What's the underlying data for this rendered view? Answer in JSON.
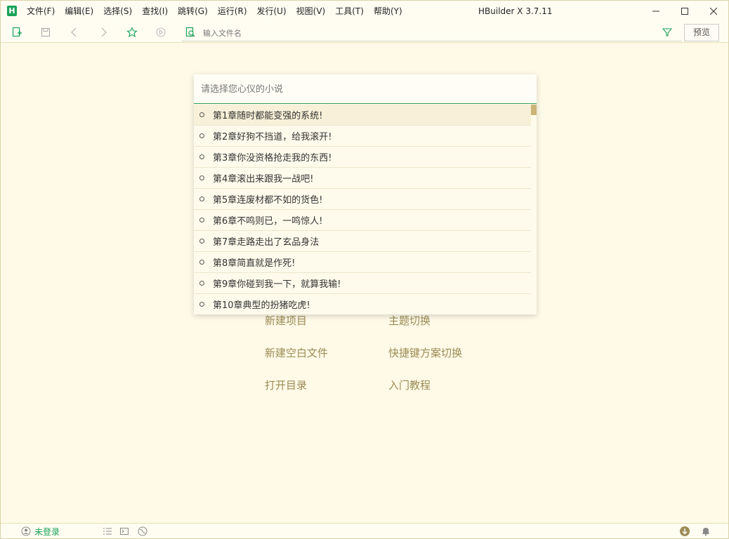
{
  "app": {
    "logo_letter": "H",
    "title": "HBuilder X 3.7.11"
  },
  "menu": [
    {
      "label": "文件(F)"
    },
    {
      "label": "编辑(E)"
    },
    {
      "label": "选择(S)"
    },
    {
      "label": "查找(I)"
    },
    {
      "label": "跳转(G)"
    },
    {
      "label": "运行(R)"
    },
    {
      "label": "发行(U)"
    },
    {
      "label": "视图(V)"
    },
    {
      "label": "工具(T)"
    },
    {
      "label": "帮助(Y)"
    }
  ],
  "toolbar": {
    "file_search_placeholder": "输入文件名",
    "preview_label": "预览"
  },
  "picker": {
    "placeholder": "请选择您心仪的小说",
    "items": [
      {
        "label": "第1章随时都能变强的系统!"
      },
      {
        "label": "第2章好狗不挡道，给我滚开!"
      },
      {
        "label": "第3章你没资格抢走我的东西!"
      },
      {
        "label": "第4章滚出来跟我一战吧!"
      },
      {
        "label": "第5章连废材都不如的货色!"
      },
      {
        "label": "第6章不鸣则已，一鸣惊人!"
      },
      {
        "label": "第7章走路走出了玄品身法"
      },
      {
        "label": "第8章简直就是作死!"
      },
      {
        "label": "第9章你碰到我一下，就算我输!"
      },
      {
        "label": "第10章典型的扮猪吃虎!"
      }
    ],
    "active_index": 0
  },
  "quick_links": {
    "new_project": "新建项目",
    "theme_switch": "主题切换",
    "new_blank_file": "新建空白文件",
    "keymap_switch": "快捷键方案切换",
    "open_directory": "打开目录",
    "tutorial": "入门教程"
  },
  "statusbar": {
    "login_status": "未登录"
  },
  "colors": {
    "accent": "#1aa35a",
    "background": "#fffae8",
    "link_text": "#9b8b55",
    "scroll_thumb": "#cdb57a"
  }
}
